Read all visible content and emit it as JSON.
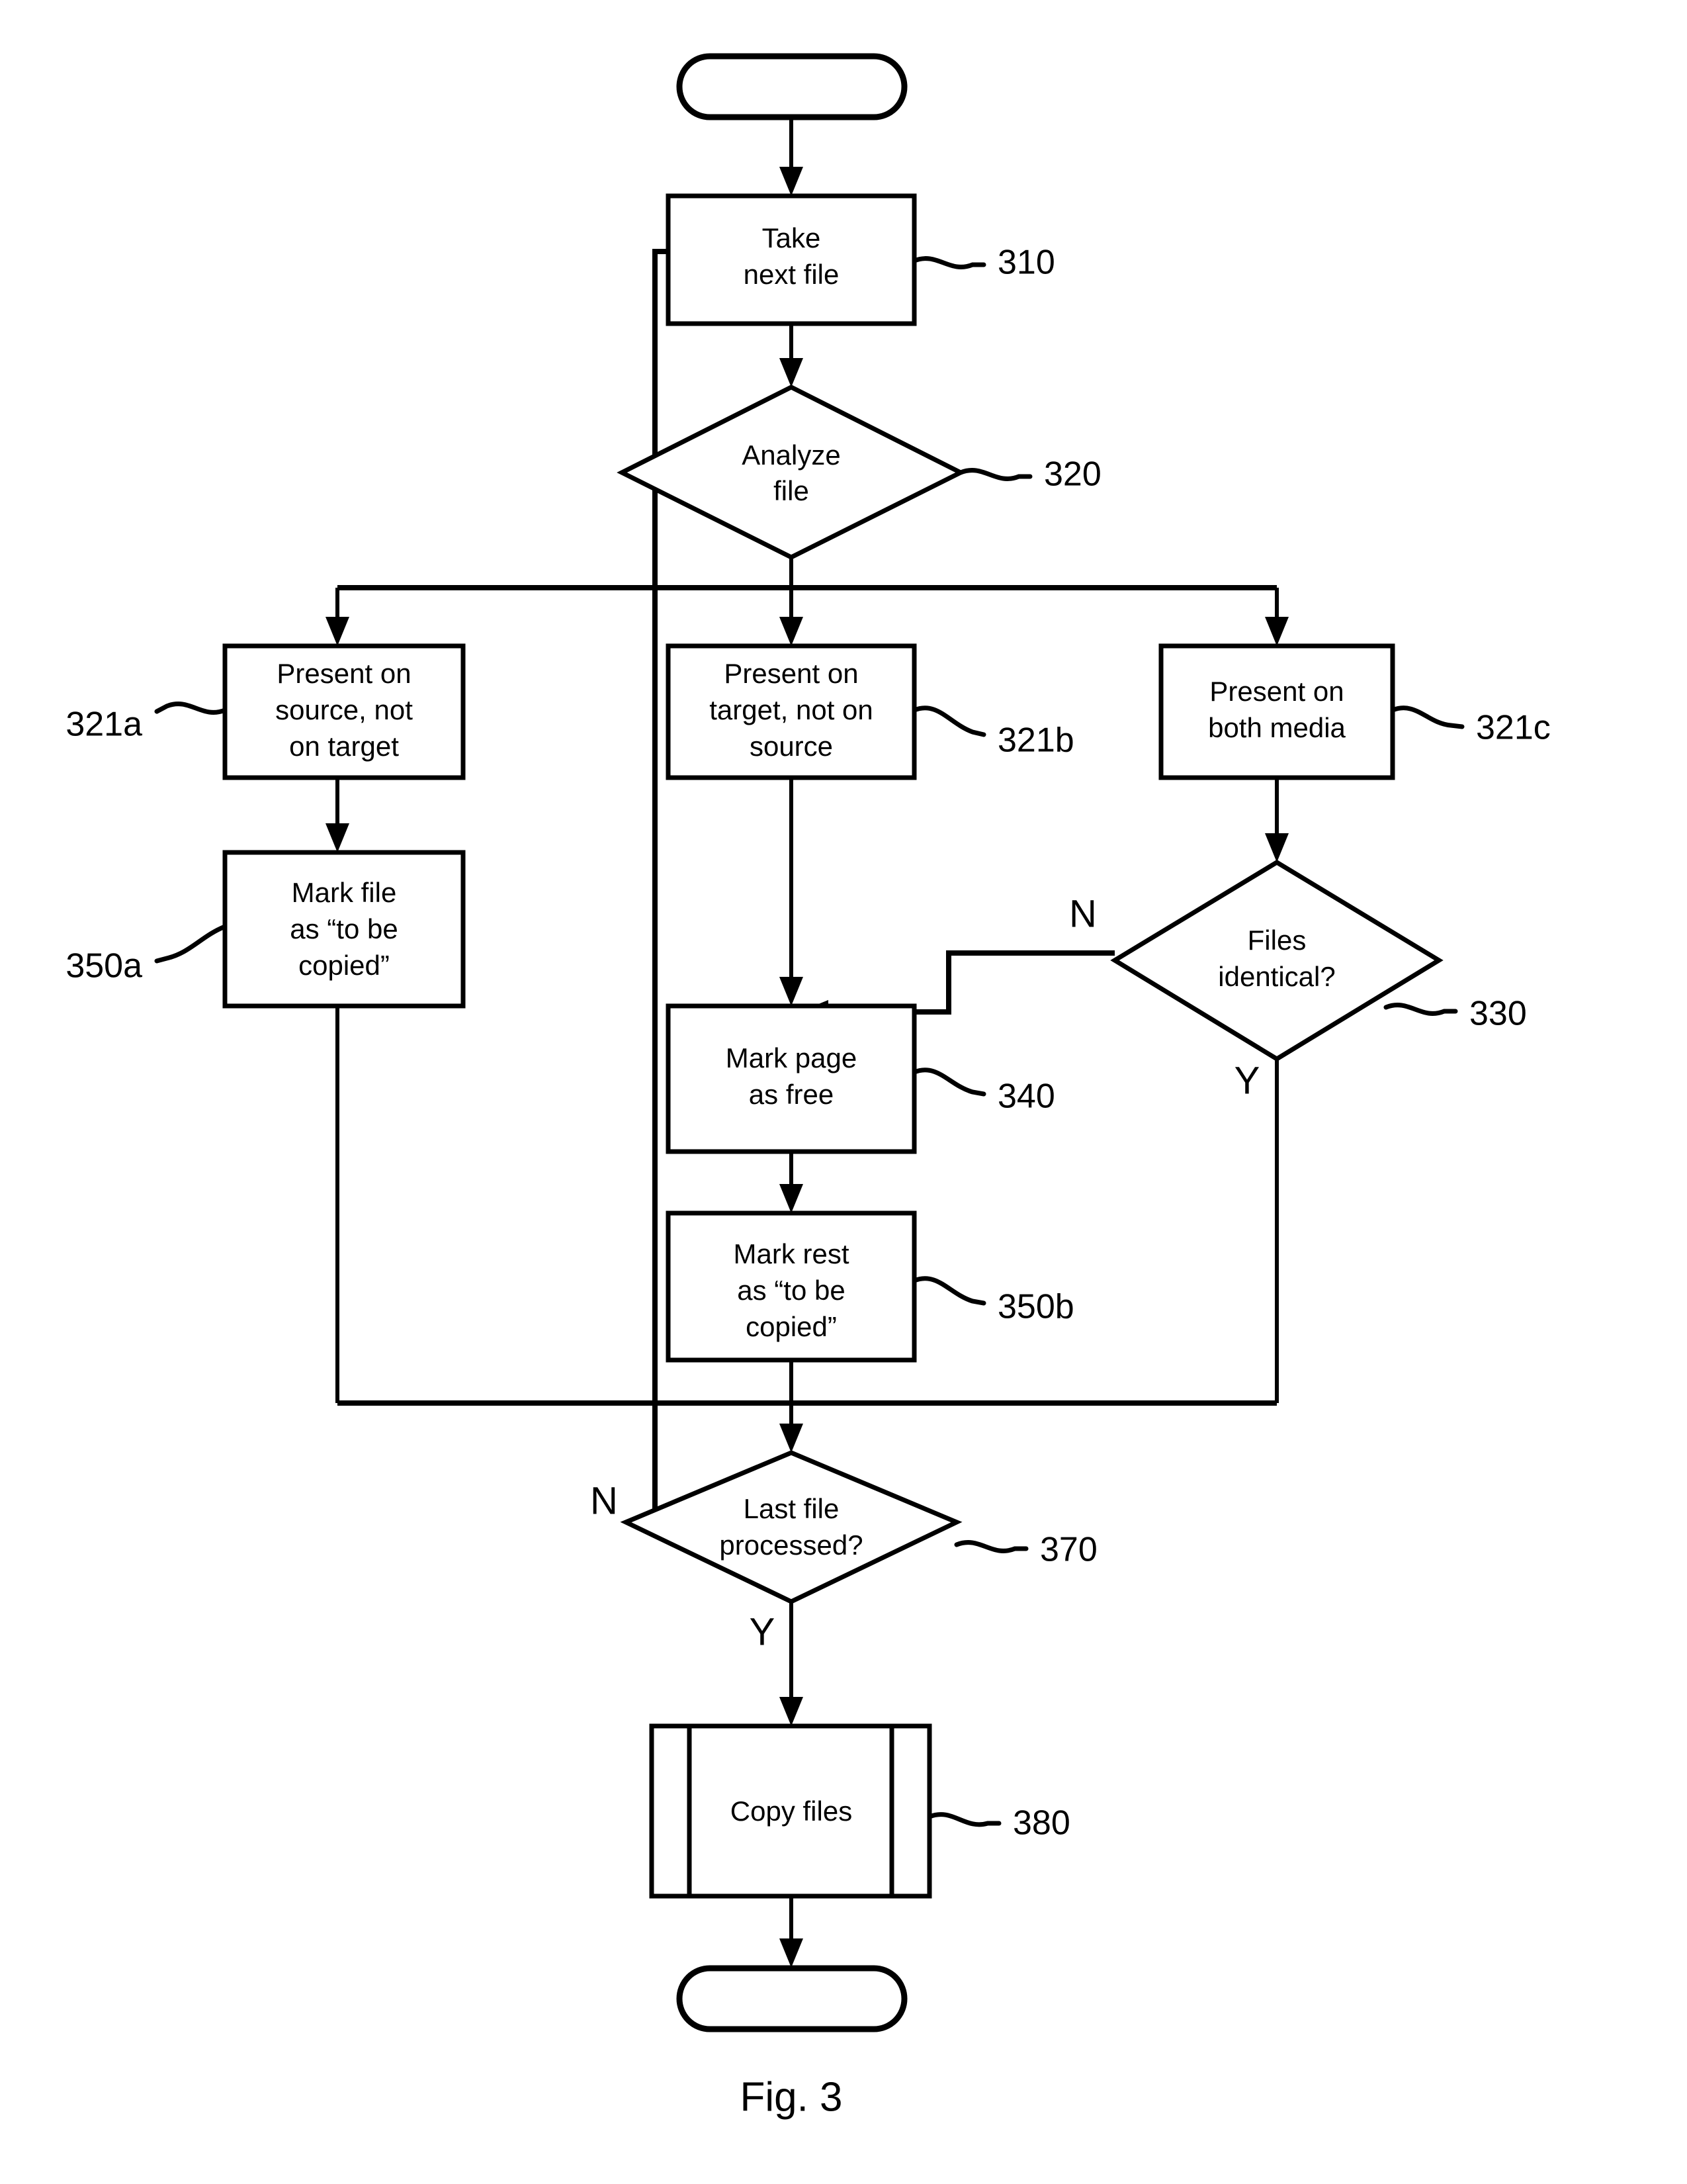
{
  "figure": {
    "caption": "Fig. 3"
  },
  "nodes": {
    "start": {
      "label": "",
      "shape": "terminator"
    },
    "take_next_file": {
      "lines": [
        "Take",
        "next file"
      ],
      "ref": "310",
      "shape": "process"
    },
    "analyze_file": {
      "lines": [
        "Analyze",
        "file"
      ],
      "ref": "320",
      "shape": "decision"
    },
    "present_source_not_target": {
      "lines": [
        "Present on",
        "source, not",
        "on target"
      ],
      "ref": "321a",
      "shape": "process"
    },
    "present_target_not_source": {
      "lines": [
        "Present on",
        "target, not on",
        "source"
      ],
      "ref": "321b",
      "shape": "process"
    },
    "present_both_media": {
      "lines": [
        "Present on",
        "both media"
      ],
      "ref": "321c",
      "shape": "process"
    },
    "mark_file_to_be_copied": {
      "lines": [
        "Mark file",
        "as “to be",
        "copied”"
      ],
      "ref": "350a",
      "shape": "process"
    },
    "files_identical": {
      "lines": [
        "Files",
        "identical?"
      ],
      "ref": "330",
      "shape": "decision"
    },
    "mark_page_as_free": {
      "lines": [
        "Mark page",
        "as free"
      ],
      "ref": "340",
      "shape": "process"
    },
    "mark_rest_to_be_copied": {
      "lines": [
        "Mark rest",
        "as “to be",
        "copied”"
      ],
      "ref": "350b",
      "shape": "process"
    },
    "last_file_processed": {
      "lines": [
        "Last file",
        "processed?"
      ],
      "ref": "370",
      "shape": "decision"
    },
    "copy_files": {
      "lines": [
        "Copy files"
      ],
      "ref": "380",
      "shape": "predefined-process"
    },
    "end": {
      "label": "",
      "shape": "terminator"
    }
  },
  "branch_labels": {
    "files_identical_no": "N",
    "files_identical_yes": "Y",
    "last_file_no": "N",
    "last_file_yes": "Y"
  },
  "colors": {
    "stroke": "#000000",
    "fill": "#ffffff",
    "background": "#ffffff"
  }
}
